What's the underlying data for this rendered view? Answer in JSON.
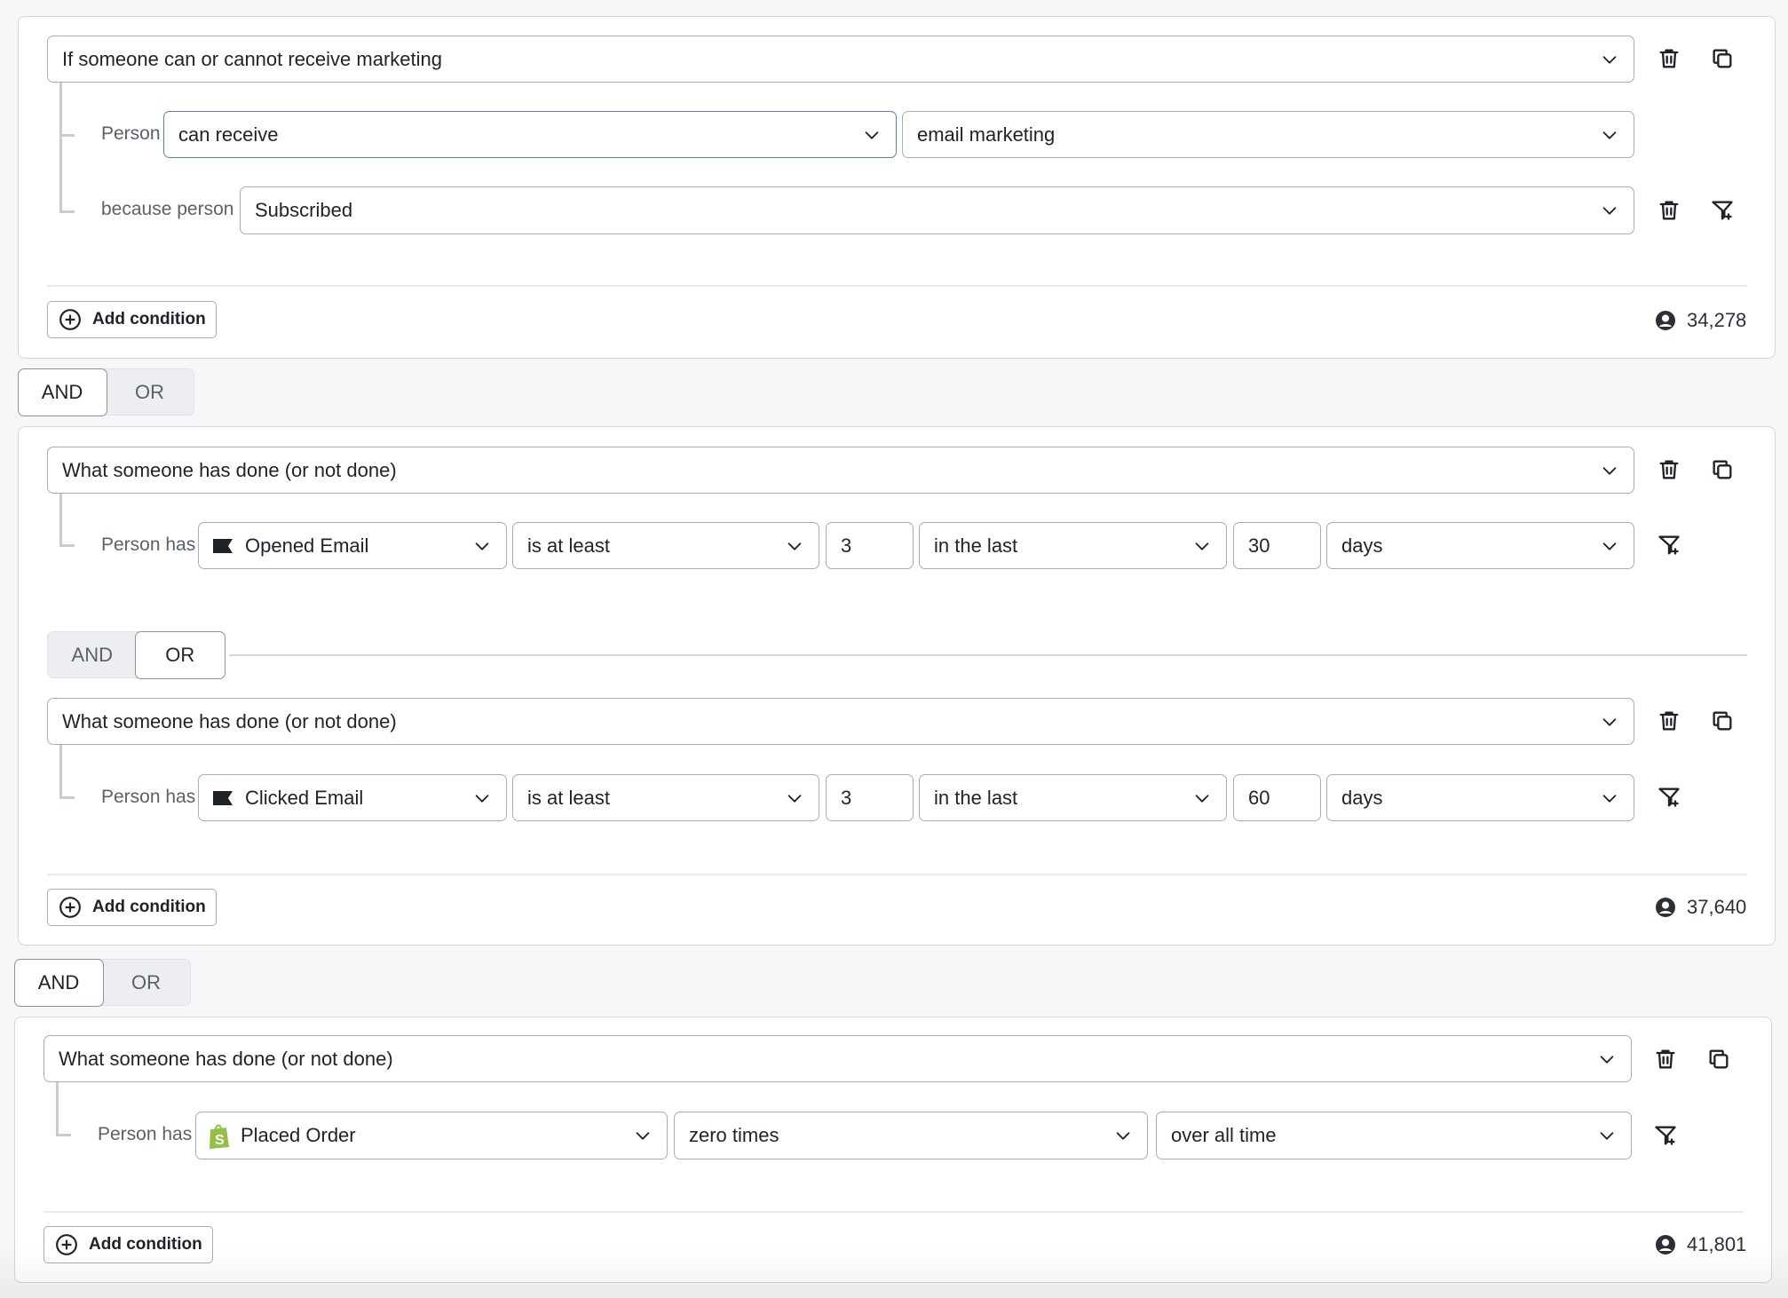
{
  "groups": [
    {
      "header": "If someone can or cannot receive marketing",
      "rows": [
        {
          "label": "Person",
          "fields": [
            "can receive",
            "email marketing"
          ]
        },
        {
          "label": "because person",
          "fields": [
            "Subscribed"
          ]
        }
      ],
      "add_condition": "Add condition",
      "count": "34,278"
    },
    {
      "conditions": [
        {
          "header": "What someone has done (or not done)",
          "row": {
            "label": "Person has",
            "metric": "Opened Email",
            "metric_icon": "flag-icon",
            "operator": "is at least",
            "value": "3",
            "timeframe": "in the last",
            "amount": "30",
            "unit": "days"
          }
        },
        {
          "header": "What someone has done (or not done)",
          "row": {
            "label": "Person has",
            "metric": "Clicked Email",
            "metric_icon": "flag-icon",
            "operator": "is at least",
            "value": "3",
            "timeframe": "in the last",
            "amount": "60",
            "unit": "days"
          }
        }
      ],
      "inner_toggle": {
        "and": "AND",
        "or": "OR",
        "selected": "OR"
      },
      "add_condition": "Add condition",
      "count": "37,640"
    },
    {
      "header": "What someone has done (or not done)",
      "row": {
        "label": "Person has",
        "metric": "Placed Order",
        "metric_icon": "shopify-icon",
        "operator": "zero times",
        "timeframe": "over all time"
      },
      "add_condition": "Add condition",
      "count": "41,801"
    }
  ],
  "toggles": [
    {
      "and": "AND",
      "or": "OR",
      "selected": "AND"
    },
    {
      "and": "AND",
      "or": "OR",
      "selected": "AND"
    }
  ],
  "colors": {
    "shopify_green": "#95bf47",
    "focus_border": "#5a7fa8"
  }
}
